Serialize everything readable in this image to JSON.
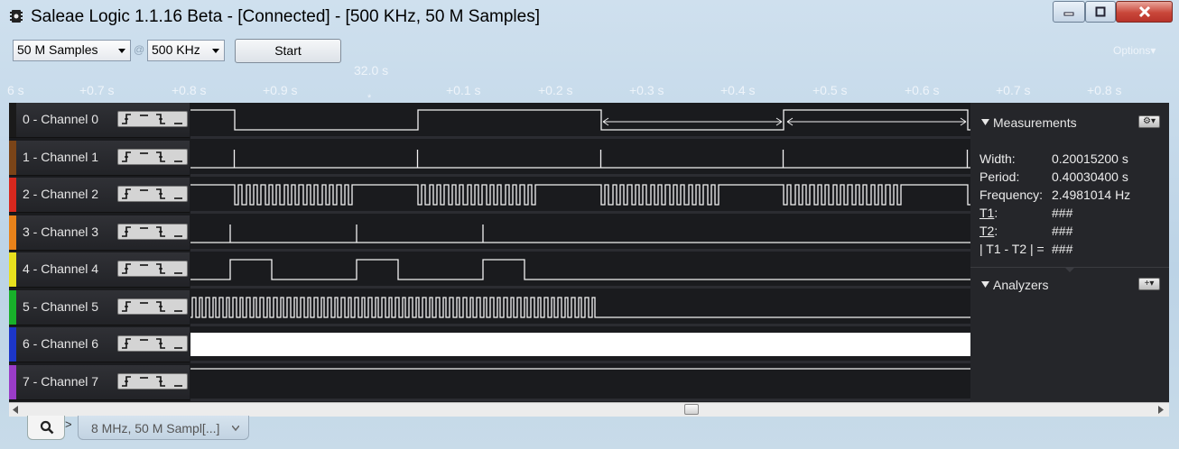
{
  "window": {
    "title": "Saleae Logic 1.1.16 Beta - [Connected] - [500 KHz, 50 M Samples]",
    "controls": [
      "minimize",
      "maximize",
      "close"
    ]
  },
  "toolbar": {
    "samples_value": "50 M Samples",
    "rate_value": "500 KHz",
    "at_sign": "@",
    "start_label": "Start",
    "options_label": "Options▾"
  },
  "ruler": {
    "center_label": "32.0 s",
    "marker": "*",
    "ticks": [
      "6 s",
      "+0.7 s",
      "+0.8 s",
      "+0.9 s",
      "+0.1 s",
      "+0.2 s",
      "+0.3 s",
      "+0.4 s",
      "+0.5 s",
      "+0.6 s",
      "+0.7 s",
      "+0.8 s"
    ]
  },
  "channels": [
    {
      "label": "0 - Channel 0",
      "color": "#1a1a1a"
    },
    {
      "label": "1 - Channel 1",
      "color": "#7a4418"
    },
    {
      "label": "2 - Channel 2",
      "color": "#d8281e"
    },
    {
      "label": "3 - Channel 3",
      "color": "#e8821a"
    },
    {
      "label": "4 - Channel 4",
      "color": "#e8e01e"
    },
    {
      "label": "5 - Channel 5",
      "color": "#18b02a"
    },
    {
      "label": "6 - Channel 6",
      "color": "#1c36c8"
    },
    {
      "label": "7 - Channel 7",
      "color": "#9a3cc8"
    }
  ],
  "measurements": {
    "title": "Measurements",
    "width_label": "Width:",
    "width_value": "0.20015200 s",
    "period_label": "Period:",
    "period_value": "0.40030400 s",
    "frequency_label": "Frequency:",
    "frequency_value": "2.4981014 Hz",
    "t1_label": "T1",
    "t1_value": "###",
    "t2_label": "T2",
    "t2_value": "###",
    "diff_label": "| T1 - T2 | =",
    "diff_value": "###"
  },
  "analyzers": {
    "title": "Analyzers"
  },
  "tabs": {
    "session_label": "8 MHz, 50 M Sampl[...]",
    "nav_glyph": ">"
  },
  "icons": [
    "app-chip-icon",
    "search-icon",
    "gear-icon",
    "plus-icon",
    "triangle-down-icon"
  ]
}
